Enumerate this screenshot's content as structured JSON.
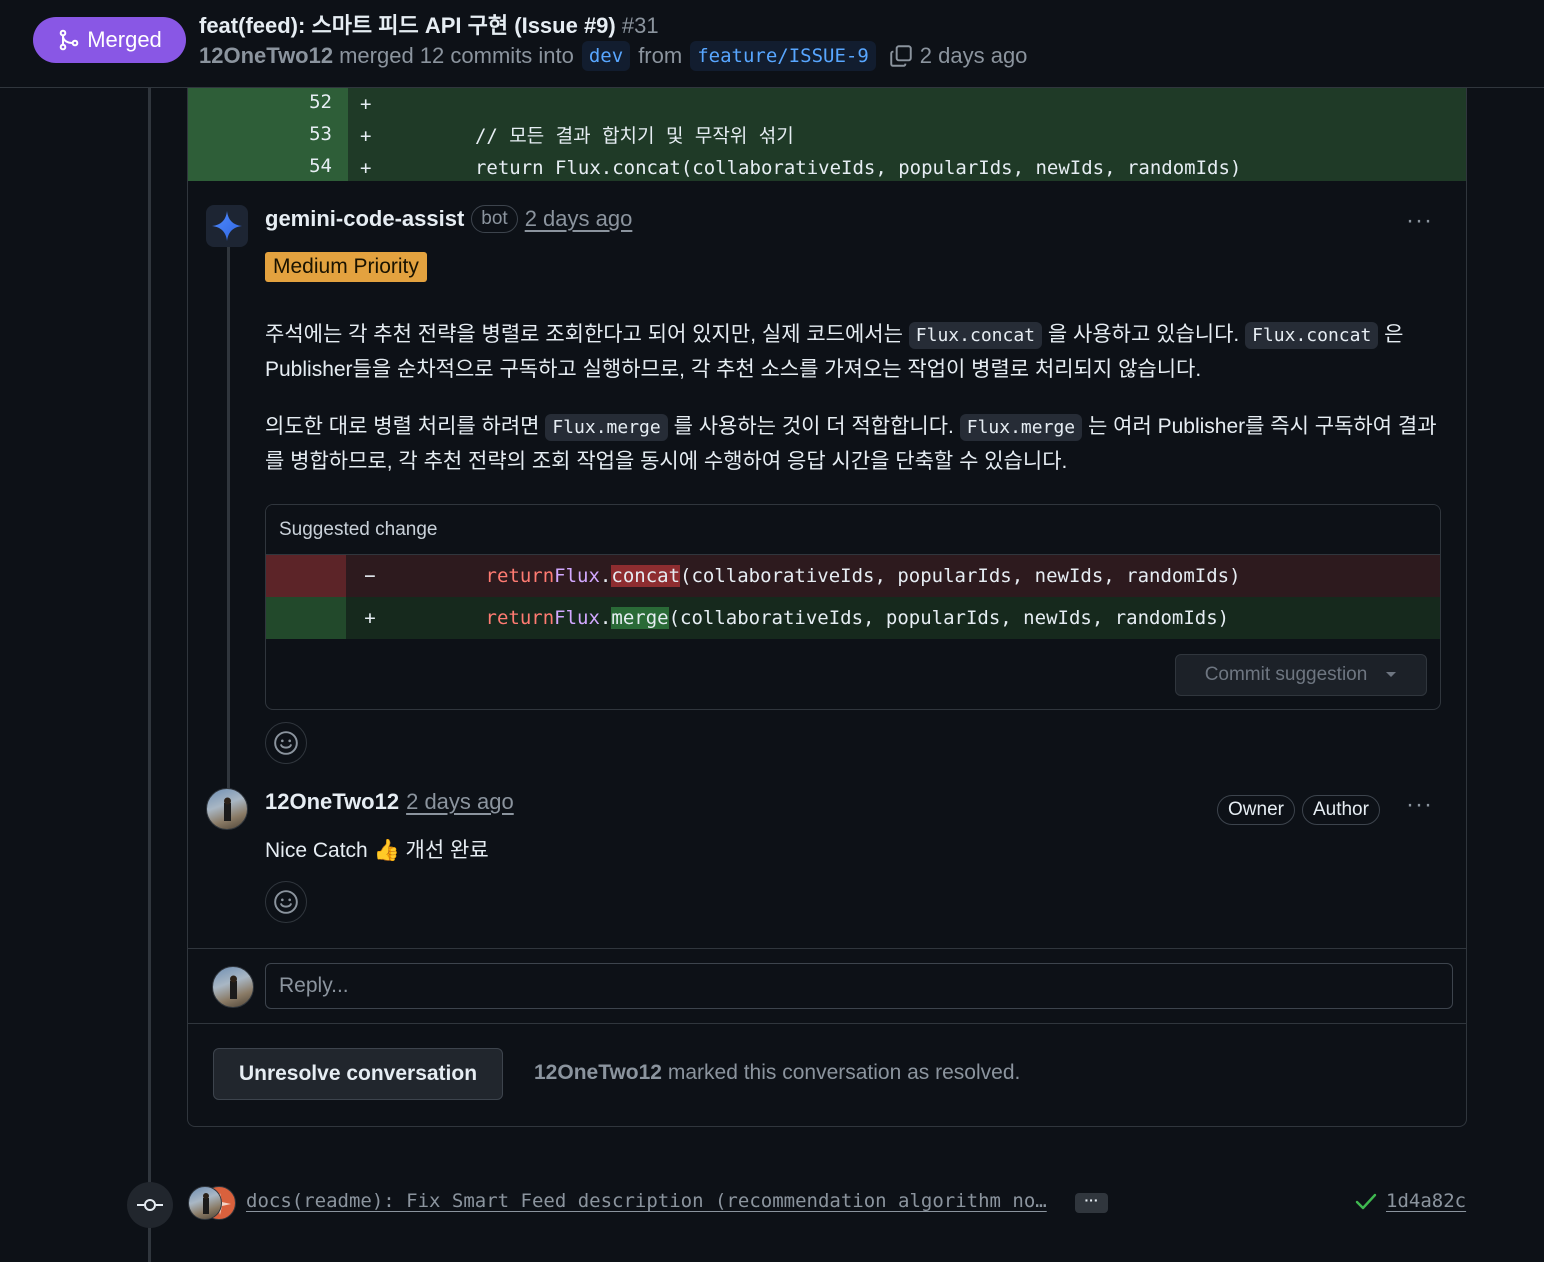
{
  "header": {
    "status": "Merged",
    "title": "feat(feed): 스마트 피드 API 구현 (Issue #9)",
    "number": "#31",
    "author": "12OneTwo12",
    "merged_text": "merged 12 commits into",
    "base_branch": "dev",
    "from_text": "from",
    "head_branch": "feature/ISSUE-9",
    "time": "2 days ago"
  },
  "diff": {
    "lines": [
      {
        "num": "52",
        "sign": "+",
        "code": ""
      },
      {
        "num": "53",
        "sign": "+",
        "code": "        // 모든 결과 합치기 및 무작위 섞기"
      },
      {
        "num": "54",
        "sign": "+",
        "code": "        return Flux.concat(collaborativeIds, popularIds, newIds, randomIds)"
      }
    ]
  },
  "comment1": {
    "author": "gemini-code-assist",
    "badge": "bot",
    "time": "2 days ago",
    "priority": "Medium Priority",
    "p1_a": "주석에는 각 추천 전략을 병렬로 조회한다고 되어 있지만, 실제 코드에서는",
    "p1_code1": "Flux.concat",
    "p1_b": "을 사용하고 있습니다.",
    "p1_code2": "Flux.concat",
    "p1_c": "은 Publisher들을 순차적으로 구독하고 실행하므로, 각 추천 소스를 가져오는 작업이 병렬로 처리되지 않습니다.",
    "p2_a": "의도한 대로 병렬 처리를 하려면",
    "p2_code1": "Flux.merge",
    "p2_b": "를 사용하는 것이 더 적합합니다.",
    "p2_code2": "Flux.merge",
    "p2_c": "는 여러 Publisher를 즉시 구독하여 결과를 병합하므로, 각 추천 전략의 조회 작업을 동시에 수행하여 응답 시간을 단축할 수 있습니다.",
    "suggestion": {
      "header": "Suggested change",
      "del_sign": "−",
      "add_sign": "+",
      "indent": "        ",
      "kw": "return",
      "cls": "Flux",
      "dot": ".",
      "del_method": "concat",
      "add_method": "merge",
      "args": "(collaborativeIds, popularIds, newIds, randomIds)",
      "commit_label": "Commit suggestion"
    }
  },
  "comment2": {
    "author": "12OneTwo12",
    "time": "2 days ago",
    "badge_owner": "Owner",
    "badge_author": "Author",
    "body": "Nice Catch 👍 개선 완료"
  },
  "reply": {
    "placeholder": "Reply..."
  },
  "resolution": {
    "button": "Unresolve conversation",
    "user": "12OneTwo12",
    "text": "marked this conversation as resolved."
  },
  "commit": {
    "message": "docs(readme): Fix Smart Feed description (recommendation algorithm no…",
    "ellipsis": "···",
    "sha": "1d4a82c"
  },
  "colors": {
    "merged": "#8957e5",
    "priority": "#e3a23f",
    "link": "#58a6ff",
    "success": "#3fb950"
  }
}
